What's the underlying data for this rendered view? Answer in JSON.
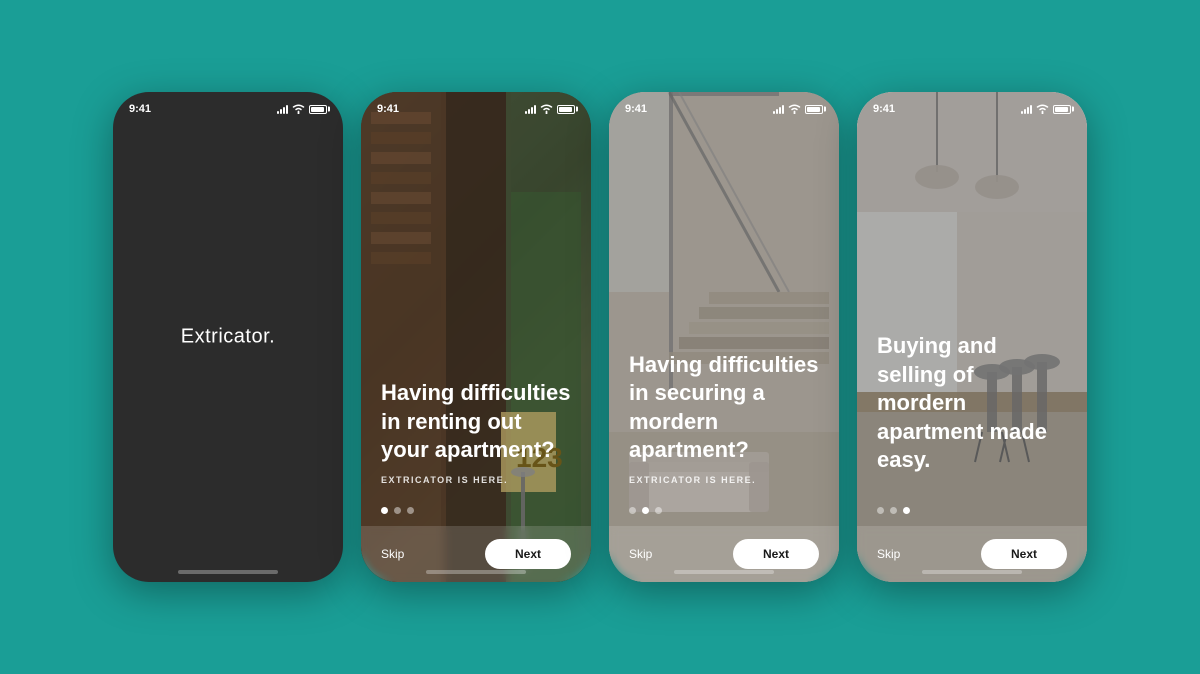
{
  "background_color": "#1a9e96",
  "phones": [
    {
      "id": "phone-1",
      "type": "splash",
      "status_time": "9:41",
      "app_name": "Extricator.",
      "home_indicator": true
    },
    {
      "id": "phone-2",
      "type": "onboarding",
      "status_time": "9:41",
      "main_text": "Having difficulties in renting out your apartment?",
      "sub_text": "EXTRICATOR IS HERE.",
      "dots": [
        true,
        false,
        false
      ],
      "skip_label": "Skip",
      "next_label": "Next",
      "home_indicator": true
    },
    {
      "id": "phone-3",
      "type": "onboarding",
      "status_time": "9:41",
      "main_text": "Having difficulties in securing a mordern apartment?",
      "sub_text": "EXTRICATOR IS HERE.",
      "dots": [
        false,
        true,
        false
      ],
      "skip_label": "Skip",
      "next_label": "Next",
      "home_indicator": true
    },
    {
      "id": "phone-4",
      "type": "onboarding",
      "status_time": "9:41",
      "main_text": "Buying and selling of mordern apartment made easy.",
      "sub_text": "",
      "dots": [
        false,
        false,
        true
      ],
      "skip_label": "Skip",
      "next_label": "Next",
      "home_indicator": true
    }
  ]
}
